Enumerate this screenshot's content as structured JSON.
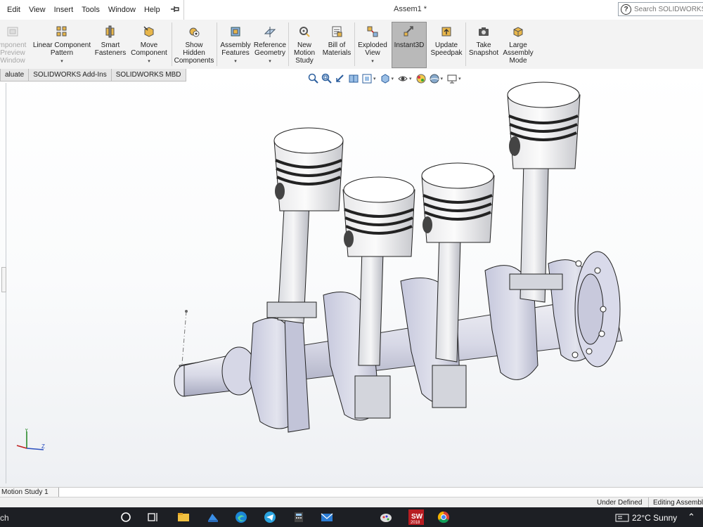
{
  "menu": {
    "items": [
      "Edit",
      "View",
      "Insert",
      "Tools",
      "Window",
      "Help"
    ],
    "pin_icon": "pin-icon"
  },
  "window": {
    "title": "Assem1 *"
  },
  "search": {
    "placeholder": "Search SOLIDWORKS Help"
  },
  "ribbon": {
    "buttons": [
      {
        "id": "component-preview-window",
        "label": "mponent\nPreview\nWindow",
        "icon": "preview-window-icon",
        "enabled": false
      },
      {
        "id": "linear-component-pattern",
        "label": "Linear Component\nPattern",
        "icon": "linear-pattern-icon",
        "dropdown": true
      },
      {
        "id": "smart-fasteners",
        "label": "Smart\nFasteners",
        "icon": "smart-fasteners-icon"
      },
      {
        "id": "move-component",
        "label": "Move\nComponent",
        "icon": "move-component-icon",
        "dropdown": true
      },
      {
        "id": "show-hidden-components",
        "label": "Show\nHidden\nComponents",
        "icon": "show-hidden-icon"
      },
      {
        "id": "assembly-features",
        "label": "Assembly\nFeatures",
        "icon": "assembly-features-icon",
        "dropdown": true
      },
      {
        "id": "reference-geometry",
        "label": "Reference\nGeometry",
        "icon": "reference-geometry-icon",
        "dropdown": true
      },
      {
        "id": "new-motion-study",
        "label": "New\nMotion\nStudy",
        "icon": "motion-study-icon"
      },
      {
        "id": "bill-of-materials",
        "label": "Bill of\nMaterials",
        "icon": "bill-of-materials-icon"
      },
      {
        "id": "exploded-view",
        "label": "Exploded\nView",
        "icon": "exploded-view-icon",
        "dropdown": true
      },
      {
        "id": "instant3d",
        "label": "Instant3D",
        "icon": "instant3d-icon",
        "active": true
      },
      {
        "id": "update-speedpak",
        "label": "Update\nSpeedpak",
        "icon": "speedpak-icon"
      },
      {
        "id": "take-snapshot",
        "label": "Take\nSnapshot",
        "icon": "camera-icon"
      },
      {
        "id": "large-assembly-mode",
        "label": "Large\nAssembly\nMode",
        "icon": "large-assembly-icon"
      }
    ]
  },
  "tabs": [
    "aluate",
    "SOLIDWORKS Add-Ins",
    "SOLIDWORKS MBD"
  ],
  "heads_up_toolbar": [
    "zoom-to-fit-icon",
    "zoom-to-area-icon",
    "previous-view-icon",
    "section-view-icon",
    "dynamic-annotation-icon",
    "view-orientation-icon",
    "display-style-icon",
    "hide-show-items-icon",
    "edit-appearance-icon",
    "apply-scene-icon",
    "view-settings-icon"
  ],
  "bottom_tabs": [
    "Motion Study 1"
  ],
  "status": {
    "defined": "Under Defined",
    "editing": "Editing Assembly"
  },
  "taskbar": {
    "search_label": "ch",
    "apps": [
      "cortana-icon",
      "task-view-icon",
      "file-explorer-icon",
      "photos-icon",
      "edge-icon",
      "telegram-icon",
      "calculator-icon",
      "mail-icon",
      "paint-icon",
      "solidworks-icon",
      "chrome-icon"
    ],
    "solidworks_badge": "2018",
    "weather": "22°C  Sunny"
  },
  "colors": {
    "ribbon_bg": "#f3f3f3",
    "active_button": "#b9b9b9",
    "taskbar": "#1d1f24",
    "part_fill": "#d4d6e6"
  }
}
